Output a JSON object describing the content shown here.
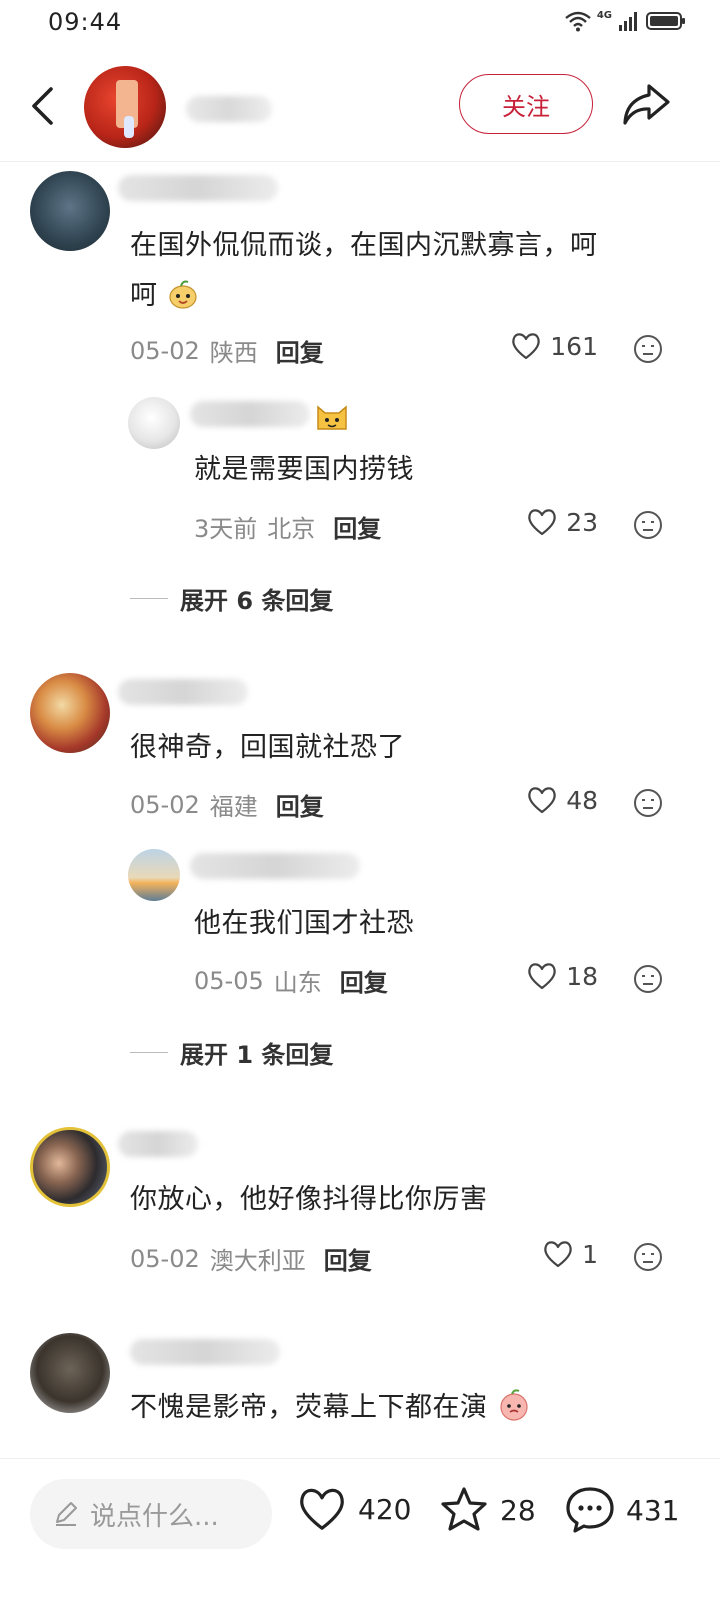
{
  "status": {
    "time": "09:44",
    "network": "4G"
  },
  "header": {
    "follow_label": "关注"
  },
  "comments": [
    {
      "text_line1": "在国外侃侃而谈，在国内沉默寡言，呵",
      "text_line2": "呵",
      "date": "05-02",
      "location": "陕西",
      "reply_label": "回复",
      "likes": "161",
      "replies": [
        {
          "text": "就是需要国内捞钱",
          "date": "3天前",
          "location": "北京",
          "reply_label": "回复",
          "likes": "23"
        }
      ],
      "expand_label": "展开 6 条回复"
    },
    {
      "text_line1": "很神奇，回国就社恐了",
      "date": "05-02",
      "location": "福建",
      "reply_label": "回复",
      "likes": "48",
      "replies": [
        {
          "text": "他在我们国才社恐",
          "date": "05-05",
          "location": "山东",
          "reply_label": "回复",
          "likes": "18"
        }
      ],
      "expand_label": "展开 1 条回复"
    },
    {
      "text_line1": "你放心，他好像抖得比你厉害",
      "date": "05-02",
      "location": "澳大利亚",
      "reply_label": "回复",
      "likes": "1"
    },
    {
      "text_line1": "不愧是影帝，荧幕上下都在演"
    }
  ],
  "bottom": {
    "input_placeholder": "说点什么...",
    "like_count": "420",
    "star_count": "28",
    "comment_count": "431"
  }
}
